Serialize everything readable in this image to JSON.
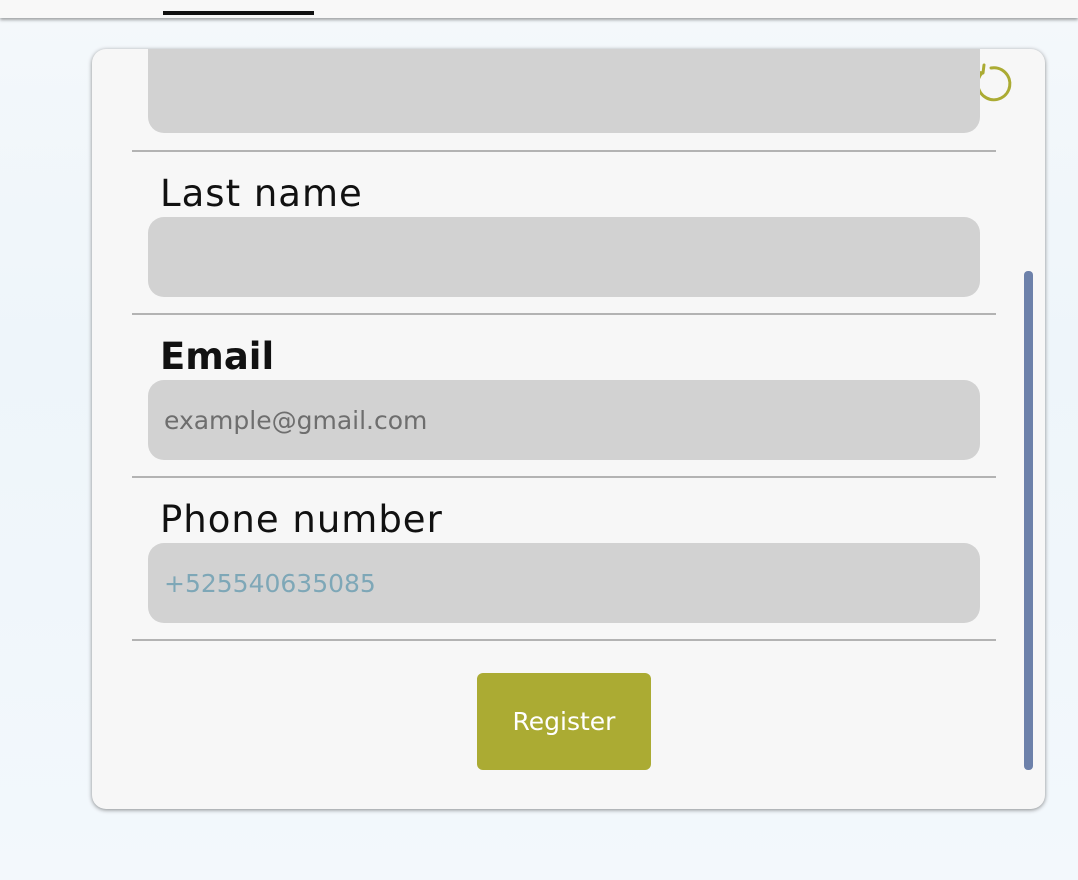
{
  "form": {
    "top_field_value": "",
    "last_name": {
      "label": "Last name",
      "value": ""
    },
    "email": {
      "label": "Email",
      "placeholder": "example@gmail.com"
    },
    "phone": {
      "label": "Phone number",
      "value": "+525540635085"
    },
    "register_label": "Register"
  },
  "icons": {
    "refresh": "refresh-icon"
  },
  "colors": {
    "accent": "#abab33",
    "scrollbar": "#6d81aa",
    "field_bg": "#d2d2d2",
    "card_bg": "#f7f7f7"
  }
}
